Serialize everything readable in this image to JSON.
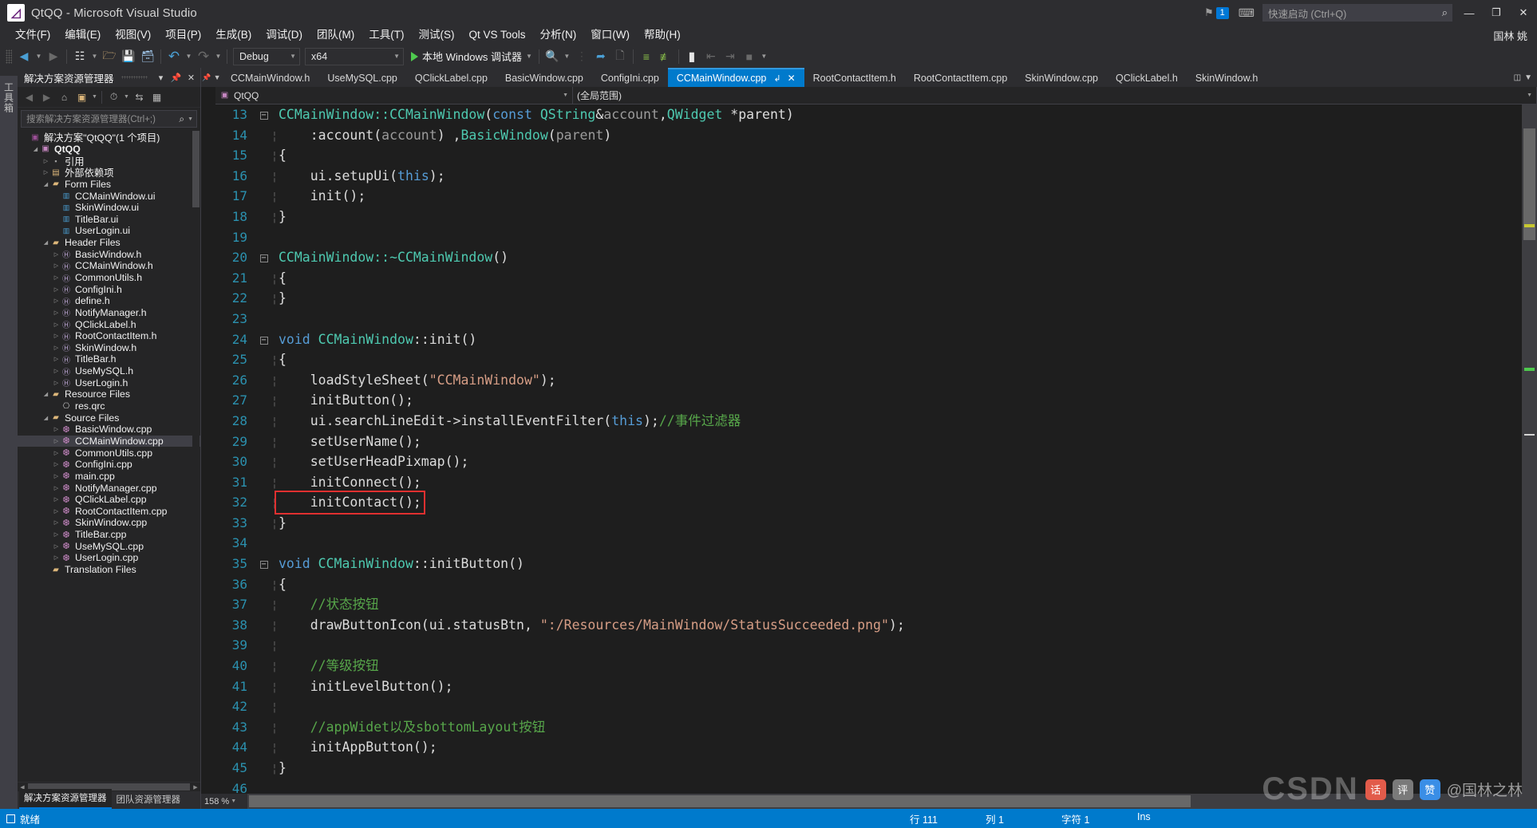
{
  "window": {
    "title": "QtQQ - Microsoft Visual Studio",
    "logo_glyph": "◧",
    "minimize": "—",
    "maximize": "❐",
    "close": "✕"
  },
  "titlebar_right": {
    "flag_icon": "⚑",
    "badge_count": "1",
    "feedback_icon": "⌨",
    "quick_launch_placeholder": "快速启动 (Ctrl+Q)",
    "quick_launch_icon": "🔍"
  },
  "menubar": {
    "items": [
      "文件(F)",
      "编辑(E)",
      "视图(V)",
      "项目(P)",
      "生成(B)",
      "调试(D)",
      "团队(M)",
      "工具(T)",
      "测试(S)",
      "Qt VS Tools",
      "分析(N)",
      "窗口(W)",
      "帮助(H)"
    ],
    "account": "国林 姚"
  },
  "toolbar": {
    "nav_back_icon": "◀",
    "nav_forward_icon": "▶",
    "new_item_icon": "▣",
    "open_icon": "🗁",
    "save_icon": "💾",
    "save_all_icon": "🖫",
    "undo_icon": "↶",
    "redo_icon": "↷",
    "config_value": "Debug",
    "platform_value": "x64",
    "run_label": "本地 Windows 调试器",
    "find_icon": "🔍",
    "icons_right": [
      "❐",
      "❑",
      "≡",
      "≣",
      "▮",
      "⇤",
      "⇥"
    ]
  },
  "solution_explorer": {
    "title": "解决方案资源管理器",
    "header_buttons": [
      "▾",
      "⏐",
      "✕"
    ],
    "toolbar_icons": [
      "◀",
      "▶",
      "⌂",
      "▣",
      "▾",
      "◴",
      "▾",
      "⇆",
      "▤"
    ],
    "search_placeholder": "搜索解决方案资源管理器(Ctrl+;)",
    "tree": [
      {
        "label": "解决方案\"QtQQ\"(1 个项目)",
        "depth": 0,
        "twisty": "",
        "icon": "sln",
        "bold": false
      },
      {
        "label": "QtQQ",
        "depth": 1,
        "twisty": "open",
        "icon": "proj",
        "bold": true
      },
      {
        "label": "引用",
        "depth": 2,
        "twisty": "closed",
        "icon": "ref",
        "bold": false
      },
      {
        "label": "外部依赖项",
        "depth": 2,
        "twisty": "closed",
        "icon": "ext",
        "bold": false
      },
      {
        "label": "Form Files",
        "depth": 2,
        "twisty": "open",
        "icon": "folder",
        "bold": false
      },
      {
        "label": "CCMainWindow.ui",
        "depth": 3,
        "twisty": "",
        "icon": "ui",
        "bold": false
      },
      {
        "label": "SkinWindow.ui",
        "depth": 3,
        "twisty": "",
        "icon": "ui",
        "bold": false
      },
      {
        "label": "TitleBar.ui",
        "depth": 3,
        "twisty": "",
        "icon": "ui",
        "bold": false
      },
      {
        "label": "UserLogin.ui",
        "depth": 3,
        "twisty": "",
        "icon": "ui",
        "bold": false
      },
      {
        "label": "Header Files",
        "depth": 2,
        "twisty": "open",
        "icon": "folder",
        "bold": false
      },
      {
        "label": "BasicWindow.h",
        "depth": 3,
        "twisty": "closed",
        "icon": "h",
        "bold": false
      },
      {
        "label": "CCMainWindow.h",
        "depth": 3,
        "twisty": "closed",
        "icon": "h",
        "bold": false
      },
      {
        "label": "CommonUtils.h",
        "depth": 3,
        "twisty": "closed",
        "icon": "h",
        "bold": false
      },
      {
        "label": "ConfigIni.h",
        "depth": 3,
        "twisty": "closed",
        "icon": "h",
        "bold": false
      },
      {
        "label": "define.h",
        "depth": 3,
        "twisty": "closed",
        "icon": "h",
        "bold": false
      },
      {
        "label": "NotifyManager.h",
        "depth": 3,
        "twisty": "closed",
        "icon": "h",
        "bold": false
      },
      {
        "label": "QClickLabel.h",
        "depth": 3,
        "twisty": "closed",
        "icon": "h",
        "bold": false
      },
      {
        "label": "RootContactItem.h",
        "depth": 3,
        "twisty": "closed",
        "icon": "h",
        "bold": false
      },
      {
        "label": "SkinWindow.h",
        "depth": 3,
        "twisty": "closed",
        "icon": "h",
        "bold": false
      },
      {
        "label": "TitleBar.h",
        "depth": 3,
        "twisty": "closed",
        "icon": "h",
        "bold": false
      },
      {
        "label": "UseMySQL.h",
        "depth": 3,
        "twisty": "closed",
        "icon": "h",
        "bold": false
      },
      {
        "label": "UserLogin.h",
        "depth": 3,
        "twisty": "closed",
        "icon": "h",
        "bold": false
      },
      {
        "label": "Resource Files",
        "depth": 2,
        "twisty": "open",
        "icon": "folder",
        "bold": false
      },
      {
        "label": "res.qrc",
        "depth": 3,
        "twisty": "",
        "icon": "qrc",
        "bold": false
      },
      {
        "label": "Source Files",
        "depth": 2,
        "twisty": "open",
        "icon": "folder",
        "bold": false
      },
      {
        "label": "BasicWindow.cpp",
        "depth": 3,
        "twisty": "closed",
        "icon": "cpp",
        "bold": false
      },
      {
        "label": "CCMainWindow.cpp",
        "depth": 3,
        "twisty": "closed",
        "icon": "cpp",
        "bold": false,
        "selected": true
      },
      {
        "label": "CommonUtils.cpp",
        "depth": 3,
        "twisty": "closed",
        "icon": "cpp",
        "bold": false
      },
      {
        "label": "ConfigIni.cpp",
        "depth": 3,
        "twisty": "closed",
        "icon": "cpp",
        "bold": false
      },
      {
        "label": "main.cpp",
        "depth": 3,
        "twisty": "closed",
        "icon": "cpp",
        "bold": false
      },
      {
        "label": "NotifyManager.cpp",
        "depth": 3,
        "twisty": "closed",
        "icon": "cpp",
        "bold": false
      },
      {
        "label": "QClickLabel.cpp",
        "depth": 3,
        "twisty": "closed",
        "icon": "cpp",
        "bold": false
      },
      {
        "label": "RootContactItem.cpp",
        "depth": 3,
        "twisty": "closed",
        "icon": "cpp",
        "bold": false
      },
      {
        "label": "SkinWindow.cpp",
        "depth": 3,
        "twisty": "closed",
        "icon": "cpp",
        "bold": false
      },
      {
        "label": "TitleBar.cpp",
        "depth": 3,
        "twisty": "closed",
        "icon": "cpp",
        "bold": false
      },
      {
        "label": "UseMySQL.cpp",
        "depth": 3,
        "twisty": "closed",
        "icon": "cpp",
        "bold": false
      },
      {
        "label": "UserLogin.cpp",
        "depth": 3,
        "twisty": "closed",
        "icon": "cpp",
        "bold": false
      },
      {
        "label": "Translation Files",
        "depth": 2,
        "twisty": "",
        "icon": "folder",
        "bold": false
      }
    ],
    "footer_tabs": [
      {
        "label": "解决方案资源管理器",
        "active": true
      },
      {
        "label": "团队资源管理器",
        "active": false
      }
    ]
  },
  "left_strip": {
    "vertical_tab": "工具箱"
  },
  "editor": {
    "tabs": [
      {
        "label": "CCMainWindow.h",
        "active": false
      },
      {
        "label": "UseMySQL.cpp",
        "active": false
      },
      {
        "label": "QClickLabel.cpp",
        "active": false
      },
      {
        "label": "BasicWindow.cpp",
        "active": false
      },
      {
        "label": "ConfigIni.cpp",
        "active": false
      },
      {
        "label": "CCMainWindow.cpp",
        "active": true
      },
      {
        "label": "RootContactItem.h",
        "active": false
      },
      {
        "label": "RootContactItem.cpp",
        "active": false
      },
      {
        "label": "SkinWindow.cpp",
        "active": false
      },
      {
        "label": "QClickLabel.h",
        "active": false
      },
      {
        "label": "SkinWindow.h",
        "active": false
      }
    ],
    "active_tab_pin_icon": "↲",
    "active_tab_close_icon": "✕",
    "nav_project": "QtQQ",
    "nav_scope": "(全局范围)",
    "zoom_level": "158 %",
    "lines": [
      {
        "num": 13,
        "fold": "minus",
        "guide": false,
        "tokens": [
          {
            "t": "CCMainWindow::CCMainWindow",
            "c": "t"
          },
          {
            "t": "(",
            "c": ""
          },
          {
            "t": "const ",
            "c": "k"
          },
          {
            "t": "QString",
            "c": "t"
          },
          {
            "t": "&",
            "c": ""
          },
          {
            "t": "account",
            "c": "p"
          },
          {
            "t": ",",
            "c": ""
          },
          {
            "t": "QWidget ",
            "c": "t"
          },
          {
            "t": "*parent)",
            "c": ""
          }
        ]
      },
      {
        "num": 14,
        "fold": "",
        "guide": true,
        "tokens": [
          {
            "t": "    :account(",
            "c": ""
          },
          {
            "t": "account",
            "c": "p"
          },
          {
            "t": ") ,",
            "c": ""
          },
          {
            "t": "BasicWindow",
            "c": "t"
          },
          {
            "t": "(",
            "c": ""
          },
          {
            "t": "parent",
            "c": "p"
          },
          {
            "t": ")",
            "c": ""
          }
        ]
      },
      {
        "num": 15,
        "fold": "",
        "guide": true,
        "tokens": [
          {
            "t": "{",
            "c": ""
          }
        ]
      },
      {
        "num": 16,
        "fold": "",
        "guide": true,
        "tokens": [
          {
            "t": "    ui.setupUi(",
            "c": ""
          },
          {
            "t": "this",
            "c": "k"
          },
          {
            "t": ");",
            "c": ""
          }
        ]
      },
      {
        "num": 17,
        "fold": "",
        "guide": true,
        "tokens": [
          {
            "t": "    init();",
            "c": ""
          }
        ]
      },
      {
        "num": 18,
        "fold": "",
        "guide": true,
        "tokens": [
          {
            "t": "}",
            "c": ""
          }
        ]
      },
      {
        "num": 19,
        "fold": "",
        "guide": false,
        "tokens": []
      },
      {
        "num": 20,
        "fold": "minus",
        "guide": false,
        "tokens": [
          {
            "t": "CCMainWindow::~CCMainWindow",
            "c": "t"
          },
          {
            "t": "()",
            "c": ""
          }
        ]
      },
      {
        "num": 21,
        "fold": "",
        "guide": true,
        "tokens": [
          {
            "t": "{",
            "c": ""
          }
        ]
      },
      {
        "num": 22,
        "fold": "",
        "guide": true,
        "tokens": [
          {
            "t": "}",
            "c": ""
          }
        ]
      },
      {
        "num": 23,
        "fold": "",
        "guide": false,
        "tokens": []
      },
      {
        "num": 24,
        "fold": "minus",
        "guide": false,
        "tokens": [
          {
            "t": "void ",
            "c": "k"
          },
          {
            "t": "CCMainWindow",
            "c": "t"
          },
          {
            "t": "::init()",
            "c": ""
          }
        ]
      },
      {
        "num": 25,
        "fold": "",
        "guide": true,
        "tokens": [
          {
            "t": "{",
            "c": ""
          }
        ]
      },
      {
        "num": 26,
        "fold": "",
        "guide": true,
        "tokens": [
          {
            "t": "    loadStyleSheet(",
            "c": ""
          },
          {
            "t": "\"CCMainWindow\"",
            "c": "s"
          },
          {
            "t": ");",
            "c": ""
          }
        ]
      },
      {
        "num": 27,
        "fold": "",
        "guide": true,
        "tokens": [
          {
            "t": "    initButton();",
            "c": ""
          }
        ]
      },
      {
        "num": 28,
        "fold": "",
        "guide": true,
        "tokens": [
          {
            "t": "    ui.searchLineEdit->installEventFilter(",
            "c": ""
          },
          {
            "t": "this",
            "c": "k"
          },
          {
            "t": ");",
            "c": ""
          },
          {
            "t": "//事件过滤器",
            "c": "c"
          }
        ]
      },
      {
        "num": 29,
        "fold": "",
        "guide": true,
        "tokens": [
          {
            "t": "    setUserName();",
            "c": ""
          }
        ]
      },
      {
        "num": 30,
        "fold": "",
        "guide": true,
        "tokens": [
          {
            "t": "    setUserHeadPixmap();",
            "c": ""
          }
        ]
      },
      {
        "num": 31,
        "fold": "",
        "guide": true,
        "tokens": [
          {
            "t": "    initConnect();",
            "c": ""
          }
        ]
      },
      {
        "num": 32,
        "fold": "",
        "guide": true,
        "highlight": true,
        "tokens": [
          {
            "t": "    initContact();",
            "c": ""
          }
        ]
      },
      {
        "num": 33,
        "fold": "",
        "guide": true,
        "tokens": [
          {
            "t": "}",
            "c": ""
          }
        ]
      },
      {
        "num": 34,
        "fold": "",
        "guide": false,
        "tokens": []
      },
      {
        "num": 35,
        "fold": "minus",
        "guide": false,
        "tokens": [
          {
            "t": "void ",
            "c": "k"
          },
          {
            "t": "CCMainWindow",
            "c": "t"
          },
          {
            "t": "::initButton()",
            "c": ""
          }
        ]
      },
      {
        "num": 36,
        "fold": "",
        "guide": true,
        "tokens": [
          {
            "t": "{",
            "c": ""
          }
        ]
      },
      {
        "num": 37,
        "fold": "",
        "guide": true,
        "tokens": [
          {
            "t": "    ",
            "c": ""
          },
          {
            "t": "//状态按钮",
            "c": "c"
          }
        ]
      },
      {
        "num": 38,
        "fold": "",
        "guide": true,
        "tokens": [
          {
            "t": "    drawButtonIcon(ui.statusBtn, ",
            "c": ""
          },
          {
            "t": "\":/Resources/MainWindow/StatusSucceeded.png\"",
            "c": "s"
          },
          {
            "t": ");",
            "c": ""
          }
        ]
      },
      {
        "num": 39,
        "fold": "",
        "guide": true,
        "tokens": []
      },
      {
        "num": 40,
        "fold": "",
        "guide": true,
        "tokens": [
          {
            "t": "    ",
            "c": ""
          },
          {
            "t": "//等级按钮",
            "c": "c"
          }
        ]
      },
      {
        "num": 41,
        "fold": "",
        "guide": true,
        "tokens": [
          {
            "t": "    initLevelButton();",
            "c": ""
          }
        ]
      },
      {
        "num": 42,
        "fold": "",
        "guide": true,
        "tokens": []
      },
      {
        "num": 43,
        "fold": "",
        "guide": true,
        "tokens": [
          {
            "t": "    ",
            "c": ""
          },
          {
            "t": "//appWidet以及sbottomLayout按钮",
            "c": "c"
          }
        ]
      },
      {
        "num": 44,
        "fold": "",
        "guide": true,
        "tokens": [
          {
            "t": "    initAppButton();",
            "c": ""
          }
        ]
      },
      {
        "num": 45,
        "fold": "",
        "guide": true,
        "tokens": [
          {
            "t": "}",
            "c": ""
          }
        ]
      },
      {
        "num": 46,
        "fold": "",
        "guide": false,
        "tokens": []
      }
    ]
  },
  "statusbar": {
    "ready": "就绪",
    "line_label": "行 111",
    "col_label": "列 1",
    "char_label": "字符 1",
    "ins_label": "Ins"
  },
  "watermark": {
    "brand": "CSDN",
    "handle": "@国林之林",
    "chip1": "话",
    "chip2": "评",
    "chip3": "赞"
  },
  "colors": {
    "accent": "#007acc",
    "chrome": "#2d2d30",
    "panel": "#252526",
    "editor_bg": "#1e1e1e",
    "highlight_box": "#e03030"
  }
}
